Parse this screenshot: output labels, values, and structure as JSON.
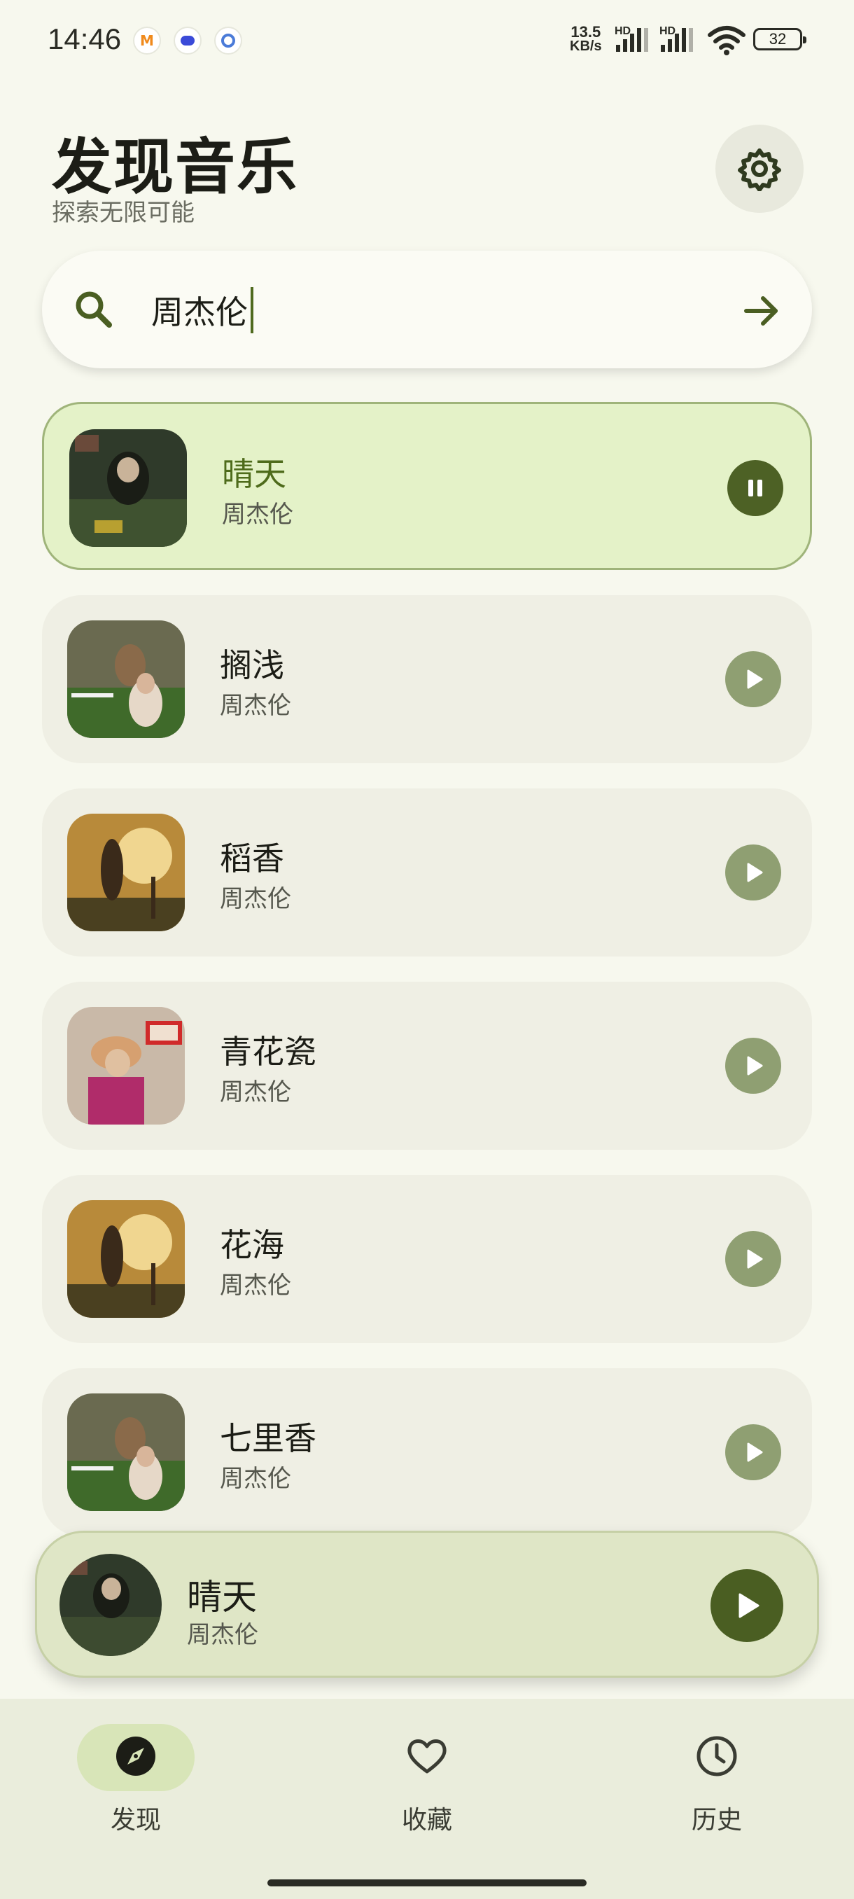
{
  "status_bar": {
    "time": "14:46",
    "net_speed_value": "13.5",
    "net_speed_unit": "KB/s",
    "hd1": "HD",
    "hd2": "HD",
    "battery": "32",
    "notification_icons": [
      "app-icon-a",
      "app-icon-b",
      "app-icon-c"
    ]
  },
  "header": {
    "title": "发现音乐",
    "subtitle": "探索无限可能"
  },
  "search": {
    "value": "周杰伦"
  },
  "songs": [
    {
      "title": "晴天",
      "artist": "周杰伦",
      "state": "playing",
      "cover_color": "#2f3a2a"
    },
    {
      "title": "搁浅",
      "artist": "周杰伦",
      "state": "paused",
      "cover_color": "#4b5a36"
    },
    {
      "title": "稻香",
      "artist": "周杰伦",
      "state": "paused",
      "cover_color": "#8a6a2e"
    },
    {
      "title": "青花瓷",
      "artist": "周杰伦",
      "state": "paused",
      "cover_color": "#6a2c2a"
    },
    {
      "title": "花海",
      "artist": "周杰伦",
      "state": "paused",
      "cover_color": "#8a6a2e"
    },
    {
      "title": "七里香",
      "artist": "周杰伦",
      "state": "paused",
      "cover_color": "#4b5a36"
    }
  ],
  "mini_player": {
    "title": "晴天",
    "artist": "周杰伦"
  },
  "nav": [
    {
      "label": "发现",
      "icon": "compass-icon",
      "active": true
    },
    {
      "label": "收藏",
      "icon": "heart-icon",
      "active": false
    },
    {
      "label": "历史",
      "icon": "clock-icon",
      "active": false
    }
  ],
  "colors": {
    "accent": "#4d6125",
    "active_card": "#e4f2c8",
    "background": "#f7f8ee"
  }
}
